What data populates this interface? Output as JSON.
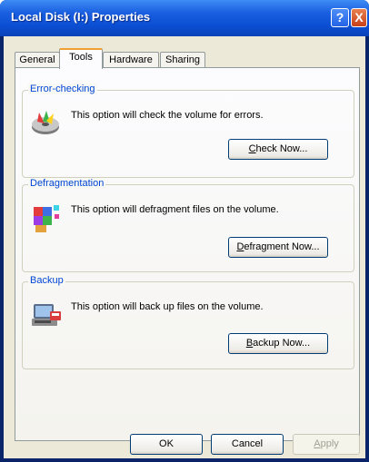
{
  "window": {
    "title": "Local Disk (I:) Properties",
    "help_label": "?",
    "close_label": "X"
  },
  "tabs": [
    {
      "label": "General",
      "active": false
    },
    {
      "label": "Tools",
      "active": true
    },
    {
      "label": "Hardware",
      "active": false
    },
    {
      "label": "Sharing",
      "active": false
    }
  ],
  "groups": {
    "error_checking": {
      "title": "Error-checking",
      "text": "This option will check the volume for errors.",
      "button_mnemonic": "C",
      "button_rest": "heck Now...",
      "icon": "disk-check-icon"
    },
    "defragmentation": {
      "title": "Defragmentation",
      "text": "This option will defragment files on the volume.",
      "button_mnemonic": "D",
      "button_rest": "efragment Now...",
      "icon": "defragment-icon"
    },
    "backup": {
      "title": "Backup",
      "text": "This option will back up files on the volume.",
      "button_mnemonic": "B",
      "button_rest": "ackup Now...",
      "icon": "backup-icon"
    }
  },
  "footer": {
    "ok_label": "OK",
    "cancel_label": "Cancel",
    "apply_mnemonic": "A",
    "apply_rest": "pply"
  },
  "colors": {
    "title_bar": "#0b4fd4",
    "group_title": "#0046d5",
    "dialog_bg": "#ece9d8"
  }
}
